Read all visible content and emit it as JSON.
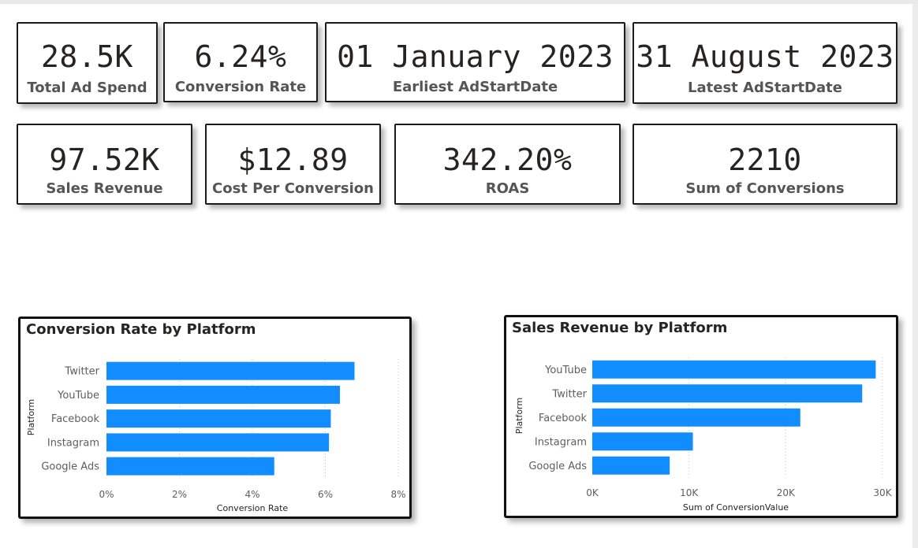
{
  "kpis": [
    {
      "value": "28.5K",
      "label": "Total Ad Spend"
    },
    {
      "value": "6.24%",
      "label": "Conversion Rate"
    },
    {
      "value": "01 January 2023",
      "label": "Earliest AdStartDate"
    },
    {
      "value": "31 August 2023",
      "label": "Latest AdStartDate"
    },
    {
      "value": "97.52K",
      "label": "Sales Revenue"
    },
    {
      "value": "$12.89",
      "label": "Cost Per Conversion"
    },
    {
      "value": "342.20%",
      "label": "ROAS"
    },
    {
      "value": "2210",
      "label": "Sum of Conversions"
    }
  ],
  "colors": {
    "bar": "#118DFF",
    "border": "#1b1b1b",
    "gridline": "#c8c6c4"
  },
  "chart_data": [
    {
      "type": "bar",
      "orientation": "horizontal",
      "title": "Conversion Rate by Platform",
      "xlabel": "Conversion Rate",
      "ylabel": "Platform",
      "categories": [
        "Twitter",
        "YouTube",
        "Facebook",
        "Instagram",
        "Google Ads"
      ],
      "values": [
        6.8,
        6.4,
        6.15,
        6.1,
        4.6
      ],
      "xlim": [
        0,
        8
      ],
      "xticks": [
        0,
        2,
        4,
        6,
        8
      ],
      "tick_labels": [
        "0%",
        "2%",
        "4%",
        "6%",
        "8%"
      ],
      "grid": true
    },
    {
      "type": "bar",
      "orientation": "horizontal",
      "title": "Sales Revenue by Platform",
      "xlabel": "Sum of ConversionValue",
      "ylabel": "Platform",
      "categories": [
        "YouTube",
        "Twitter",
        "Facebook",
        "Instagram",
        "Google Ads"
      ],
      "values": [
        29300,
        27900,
        21500,
        10400,
        8000
      ],
      "xlim": [
        0,
        30000
      ],
      "xticks": [
        0,
        10000,
        20000,
        30000
      ],
      "tick_labels": [
        "0K",
        "10K",
        "20K",
        "30K"
      ],
      "grid": true
    }
  ]
}
